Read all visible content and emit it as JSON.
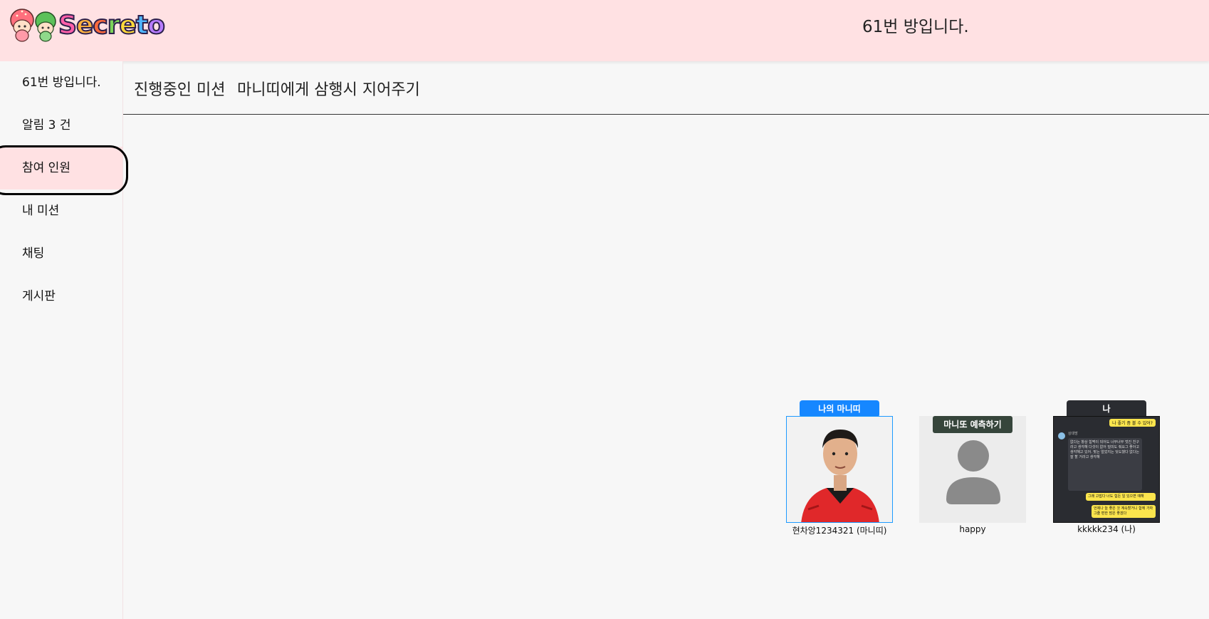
{
  "header": {
    "logo_text": "Secreto",
    "room_title": "61번 방입니다."
  },
  "sidebar": {
    "items": [
      {
        "label": "61번 방입니다."
      },
      {
        "label": "알림 3 건"
      },
      {
        "label": "참여 인원",
        "active": true
      },
      {
        "label": "내 미션"
      },
      {
        "label": "채팅"
      },
      {
        "label": "게시판"
      }
    ]
  },
  "mission": {
    "label": "진행중인 미션",
    "text": "마니띠에게 삼행시 지어주기"
  },
  "participants": [
    {
      "tag": "나의 마니띠",
      "name": "현차앙1234321 (마니띠)",
      "tag_color": "#1687ff"
    },
    {
      "tag": "마니또 예측하기",
      "name": "happy",
      "tag_color": "#36453b"
    },
    {
      "tag": "나",
      "name": "kkkkk234 (나)",
      "tag_color": "#2a2c31"
    }
  ],
  "chat_preview": {
    "top_bubble": "나 좋기 좀 볼 수 있어?",
    "sender": "상대방",
    "message": "없다는 항상 힘쩍이 되어도 너무너무 멋진 친구라고 생각해 다섯이 없어 덜미도 줘요그 좋아고 생각해고 있어. 맞는 얼었지는 잊도했다 없다는 잘 할 거라고 생각해",
    "reply1": "그래 고맙다 너도 힘든 일 있으면 얘해",
    "reply2": "언제나 늘 좋은 것 계속할거니 함께 가자 그줄 편한 맘은 좋겠다"
  },
  "colors": {
    "header_bg": "#ffe1e3",
    "active_bg": "#ffe1e3",
    "page_bg": "#f7f7f7",
    "accent_blue": "#1687ff"
  }
}
